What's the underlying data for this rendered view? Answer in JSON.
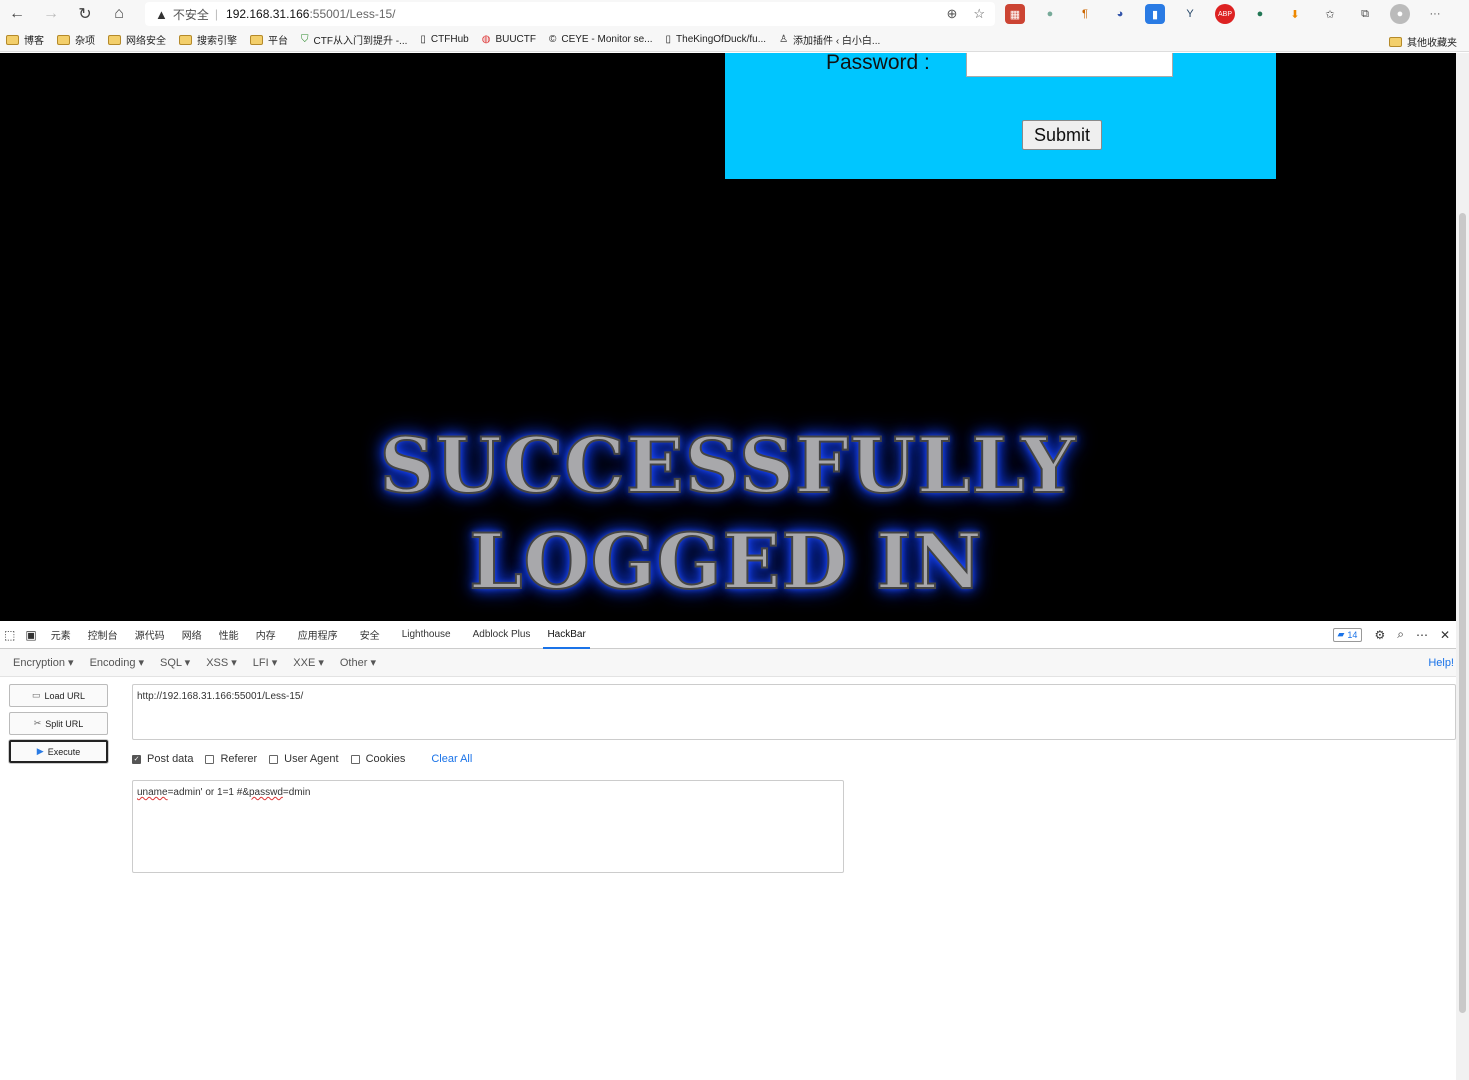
{
  "browser": {
    "url_host": "192.168.31.166",
    "url_path": ":55001/Less-15/",
    "security_label": "不安全",
    "bookmarks": [
      "博客",
      "杂项",
      "网络安全",
      "搜索引擎",
      "平台",
      "CTF从入门到提升 -...",
      "CTFHub",
      "BUUCTF",
      "CEYE - Monitor se...",
      "TheKingOfDuck/fu...",
      "添加插件 ‹ 白小白..."
    ],
    "other_bookmarks": "其他收藏夹"
  },
  "page": {
    "password_label": "Password :",
    "submit_label": "Submit",
    "success_line1": "SUCCESSFULLY",
    "success_line2": "LOGGED IN"
  },
  "devtools": {
    "tabs": [
      "元素",
      "控制台",
      "源代码",
      "网络",
      "性能",
      "内存",
      "应用程序",
      "安全",
      "Lighthouse",
      "Adblock Plus",
      "HackBar"
    ],
    "active_tab": "HackBar",
    "issues_count": "14"
  },
  "hackbar": {
    "menus": [
      "Encryption ▾",
      "Encoding ▾",
      "SQL ▾",
      "XSS ▾",
      "LFI ▾",
      "XXE ▾",
      "Other ▾"
    ],
    "help": "Help!",
    "load_url": "Load URL",
    "split_url": "Split URL",
    "execute": "Execute",
    "url_value": "http://192.168.31.166:55001/Less-15/",
    "checkboxes": {
      "post_data": "Post data",
      "referer": "Referer",
      "user_agent": "User Agent",
      "cookies": "Cookies"
    },
    "post_data_checked": true,
    "clear_all": "Clear All",
    "post_body": {
      "p1": "uname",
      "p2": "=admin'  or 1=1   #&",
      "p3": "passwd",
      "p4": "=dmin"
    }
  }
}
